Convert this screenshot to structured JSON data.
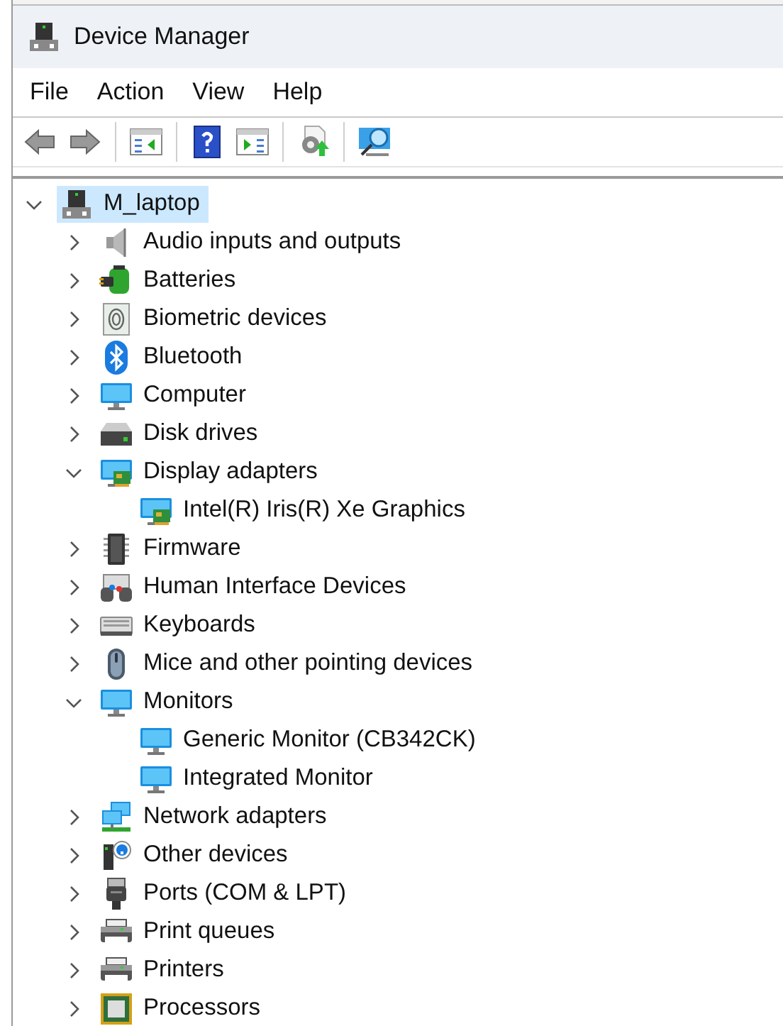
{
  "window": {
    "title": "Device Manager"
  },
  "menu": [
    {
      "label": "File"
    },
    {
      "label": "Action"
    },
    {
      "label": "View"
    },
    {
      "label": "Help"
    }
  ],
  "toolbar": [
    {
      "kind": "back"
    },
    {
      "kind": "forward"
    },
    {
      "kind": "separator"
    },
    {
      "kind": "tree-pane"
    },
    {
      "kind": "separator"
    },
    {
      "kind": "help"
    },
    {
      "kind": "action-pane"
    },
    {
      "kind": "separator"
    },
    {
      "kind": "update"
    },
    {
      "kind": "separator"
    },
    {
      "kind": "scan"
    }
  ],
  "tree": {
    "label": "M_laptop",
    "kind": "computer-root",
    "expanded": true,
    "selected": true,
    "children": [
      {
        "label": "Audio inputs and outputs",
        "kind": "audio",
        "expanded": false,
        "selected": false
      },
      {
        "label": "Batteries",
        "kind": "battery",
        "expanded": false,
        "selected": false
      },
      {
        "label": "Biometric devices",
        "kind": "biometric",
        "expanded": false,
        "selected": false
      },
      {
        "label": "Bluetooth",
        "kind": "bluetooth",
        "expanded": false,
        "selected": false
      },
      {
        "label": "Computer",
        "kind": "monitor",
        "expanded": false,
        "selected": false
      },
      {
        "label": "Disk drives",
        "kind": "disk",
        "expanded": false,
        "selected": false
      },
      {
        "label": "Display adapters",
        "kind": "display",
        "expanded": true,
        "selected": false,
        "children": [
          {
            "label": "Intel(R) Iris(R) Xe Graphics",
            "kind": "display",
            "selected": false
          }
        ]
      },
      {
        "label": "Firmware",
        "kind": "chip",
        "expanded": false,
        "selected": false
      },
      {
        "label": "Human Interface Devices",
        "kind": "hid",
        "expanded": false,
        "selected": false
      },
      {
        "label": "Keyboards",
        "kind": "keyboard",
        "expanded": false,
        "selected": false
      },
      {
        "label": "Mice and other pointing devices",
        "kind": "mouse",
        "expanded": false,
        "selected": false
      },
      {
        "label": "Monitors",
        "kind": "monitor",
        "expanded": true,
        "selected": false,
        "children": [
          {
            "label": "Generic Monitor (CB342CK)",
            "kind": "monitor",
            "selected": false
          },
          {
            "label": "Integrated Monitor",
            "kind": "monitor",
            "selected": false
          }
        ]
      },
      {
        "label": "Network adapters",
        "kind": "network",
        "expanded": false,
        "selected": false
      },
      {
        "label": "Other devices",
        "kind": "other",
        "expanded": false,
        "selected": false
      },
      {
        "label": "Ports (COM & LPT)",
        "kind": "port",
        "expanded": false,
        "selected": false
      },
      {
        "label": "Print queues",
        "kind": "printer",
        "expanded": false,
        "selected": false
      },
      {
        "label": "Printers",
        "kind": "printer",
        "expanded": false,
        "selected": false
      },
      {
        "label": "Processors",
        "kind": "processor",
        "expanded": false,
        "selected": false
      }
    ]
  }
}
